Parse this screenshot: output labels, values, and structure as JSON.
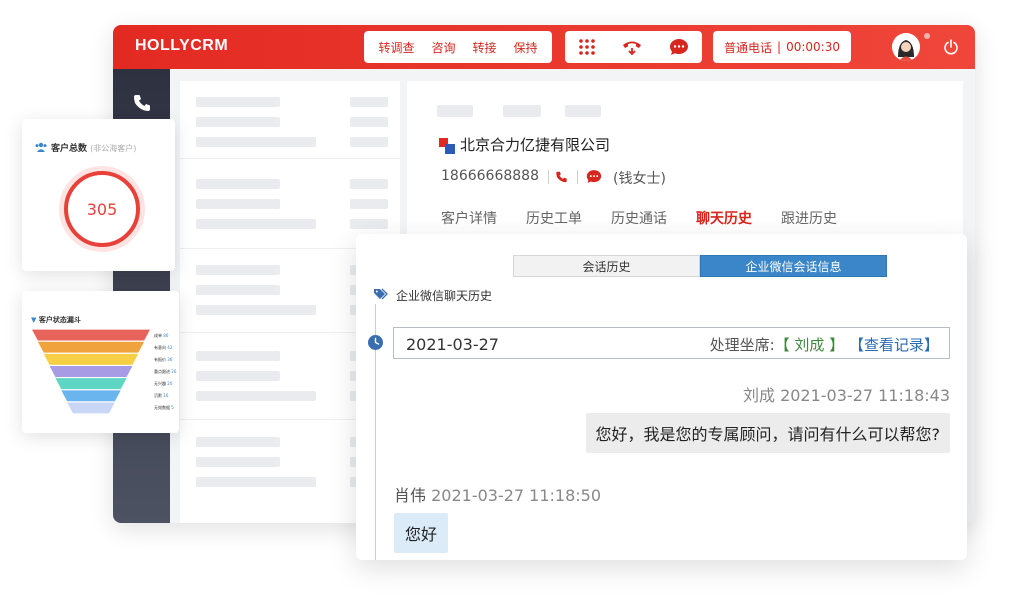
{
  "app": {
    "brand": "HOLLYCRM",
    "actions": [
      "转调查",
      "咨询",
      "转接",
      "保持"
    ],
    "status": {
      "type": "普通电话",
      "separator": "|",
      "timer": "00:00:30"
    }
  },
  "customer": {
    "company": "北京合力亿捷有限公司",
    "phone": "18666668888",
    "contact": "(钱女士)"
  },
  "tabs": [
    "客户详情",
    "历史工单",
    "历史通话",
    "聊天历史",
    "跟进历史"
  ],
  "active_tab": "聊天历史",
  "chat": {
    "segments": [
      "会话历史",
      "企业微信会话信息"
    ],
    "active_segment": "企业微信会话信息",
    "section_title": "企业微信聊天历史",
    "date": "2021-03-27",
    "handler_label": "处理坐席:",
    "handler_name": "【 刘成 】",
    "view_link": "【查看记录】",
    "messages": [
      {
        "sender": "刘成",
        "time": "2021-03-27 11:18:43",
        "text": "您好，我是您的专属顾问，请问有什么可以帮您?",
        "side": "right"
      },
      {
        "sender": "肖伟",
        "time": "2021-03-27 11:18:50",
        "text": "您好",
        "side": "left"
      }
    ]
  },
  "widgets": {
    "total": {
      "title": "客户总数",
      "subtitle": "(非公海客户)",
      "value": "305"
    },
    "funnel": {
      "title": "客户状态漏斗",
      "stages": [
        {
          "label": "成单",
          "value": "86",
          "color": "#e8635c"
        },
        {
          "label": "有意向",
          "value": "42",
          "color": "#f0a33c"
        },
        {
          "label": "有报价",
          "value": "36",
          "color": "#f7cf45"
        },
        {
          "label": "重点跟进",
          "value": "26",
          "color": "#a89be6"
        },
        {
          "label": "无兴趣",
          "value": "20",
          "color": "#5fd6c4"
        },
        {
          "label": "沉默",
          "value": "16",
          "color": "#6ab5ee"
        },
        {
          "label": "无效数据",
          "value": "5",
          "color": "#c9d6f6"
        }
      ]
    }
  },
  "colors": {
    "brand_red": "#e32a22",
    "accent_blue": "#3a86c8",
    "sidebar": "#2e3140"
  }
}
